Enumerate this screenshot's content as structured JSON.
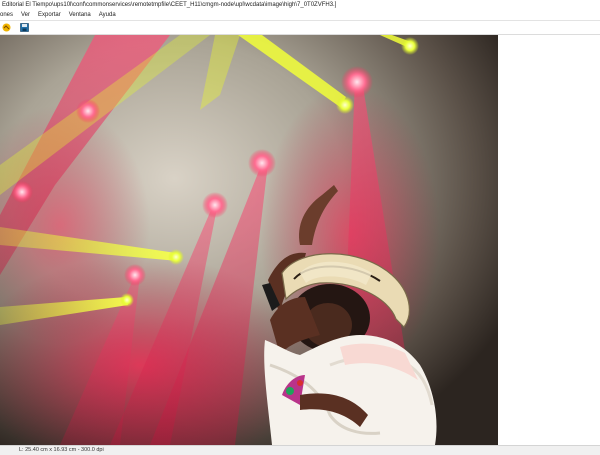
{
  "window": {
    "title": "Editorial El Tiempo\\ups10l\\conf\\commonservices\\remotetmpfile\\CEET_H11\\cmgm-node\\upl\\wcdata\\image\\high\\7_0T0ZVFH3.]"
  },
  "menu": {
    "items": [
      {
        "label": "ones"
      },
      {
        "label": "Ver"
      },
      {
        "label": "Exportar"
      },
      {
        "label": "Ventana"
      },
      {
        "label": "Ayuda"
      }
    ]
  },
  "toolbar": {
    "buttons": [
      {
        "icon": "open-image-icon"
      },
      {
        "icon": "save-image-icon"
      }
    ]
  },
  "photo": {
    "subject": "singer-performing-on-stage",
    "palette": {
      "smoke": "#b9b2a6",
      "red_beam": "#e8204a",
      "yellow_beam": "#e9f51c",
      "dress": "#f6f2ec",
      "hat": "#efe3c2"
    }
  },
  "status": {
    "text": "L: 25.40 cm x 16.93 cm - 300.0 dpi"
  }
}
